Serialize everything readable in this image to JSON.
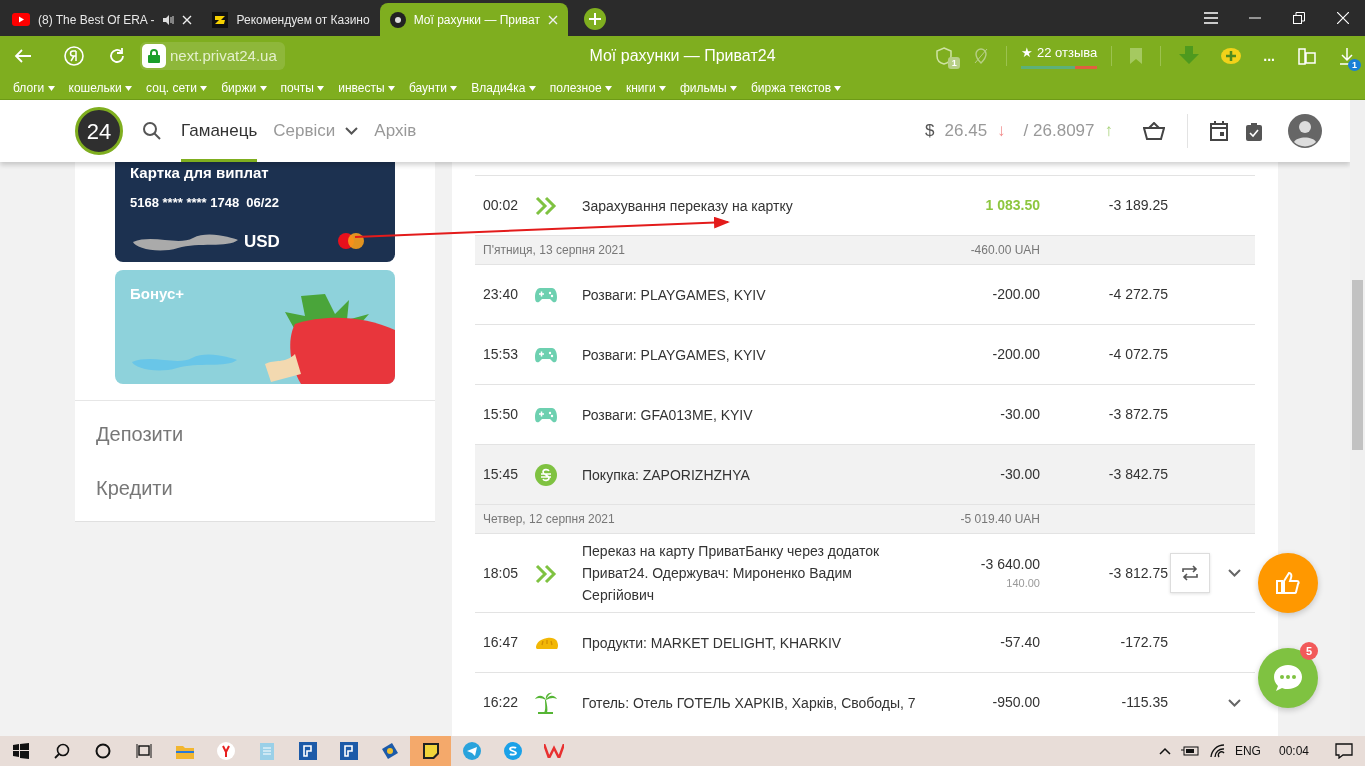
{
  "browser": {
    "tabs": [
      {
        "title": "(8) The Best Of ERA -",
        "kind": "youtube",
        "audio": true,
        "closable": true,
        "selected": false
      },
      {
        "title": "Рекомендуем от Казино",
        "kind": "casino",
        "audio": false,
        "closable": false,
        "selected": false
      },
      {
        "title": "Мої рахунки — Приват",
        "kind": "privat",
        "audio": false,
        "closable": true,
        "selected": true
      }
    ],
    "address": "next.privat24.ua",
    "page_title": "Мої рахунки — Приват24",
    "shield_badge": "1",
    "reviews": {
      "label": "★ 22 отзыва",
      "level": 0.7
    },
    "more": "...",
    "downloads_badge": "1",
    "bookmarks": [
      "блоги",
      "кошельки",
      "соц. сети",
      "биржи",
      "почты",
      "инвесты",
      "баунти",
      "Влади4ка",
      "полезное",
      "книги",
      "фильмы",
      "биржа текстов"
    ]
  },
  "site": {
    "logo": "24",
    "nav": [
      {
        "label": "Гаманець",
        "selected": true,
        "dropdown": false
      },
      {
        "label": "Сервіси",
        "selected": false,
        "dropdown": true
      },
      {
        "label": "Архів",
        "selected": false,
        "dropdown": false
      }
    ],
    "rate": {
      "currency": "$",
      "buy": "26.45",
      "buy_arrow": "↓",
      "sell": "/ 26.8097",
      "sell_arrow": "↑"
    }
  },
  "cards": [
    {
      "kind": "payout",
      "title": "Картка для виплат",
      "number": "5168 **** **** 1748  06/22",
      "balance": "USD"
    },
    {
      "kind": "bonus",
      "title": "Бонус+"
    }
  ],
  "menu": [
    "Депозити",
    "Кредити"
  ],
  "transactions": [
    {
      "kind": "tx",
      "time": "00:02",
      "icon": {
        "kind": "transfer"
      },
      "text": "Зарахування переказу на картку",
      "amount": "1 083.50",
      "income": true,
      "balance": "-3 189.25",
      "hovered": false,
      "repeat": false,
      "expandable": false
    },
    {
      "kind": "date",
      "label": "П'ятниця, 13 серпня 2021",
      "total": "-460.00 UAH"
    },
    {
      "kind": "tx",
      "time": "23:40",
      "icon": {
        "kind": "game"
      },
      "text": "Розваги: PLAYGAMES, KYIV",
      "amount": "-200.00",
      "income": false,
      "balance": "-4 272.75",
      "hovered": false,
      "repeat": false,
      "expandable": false
    },
    {
      "kind": "tx",
      "time": "15:53",
      "icon": {
        "kind": "game"
      },
      "text": "Розваги: PLAYGAMES, KYIV",
      "amount": "-200.00",
      "income": false,
      "balance": "-4 072.75",
      "hovered": false,
      "repeat": false,
      "expandable": false
    },
    {
      "kind": "tx",
      "time": "15:50",
      "icon": {
        "kind": "game"
      },
      "text": "Розваги: GFA013ME, KYIV",
      "amount": "-30.00",
      "income": false,
      "balance": "-3 872.75",
      "hovered": false,
      "repeat": false,
      "expandable": false
    },
    {
      "kind": "tx",
      "time": "15:45",
      "icon": {
        "kind": "purchase"
      },
      "text": "Покупка: ZAPORIZHZHYA",
      "amount": "-30.00",
      "income": false,
      "balance": "-3 842.75",
      "hovered": true,
      "repeat": false,
      "expandable": false
    },
    {
      "kind": "date",
      "label": "Четвер, 12 серпня 2021",
      "total": "-5 019.40 UAH"
    },
    {
      "kind": "tx",
      "time": "18:05",
      "icon": {
        "kind": "transfer"
      },
      "text": "Переказ на карту ПриватБанку через додаток Приват24. Одержувач: Мироненко Вадим Сергійович",
      "amount": "-3 640.00",
      "fee": "140.00",
      "income": false,
      "balance": "-3 812.75",
      "hovered": false,
      "repeat": true,
      "expandable": true
    },
    {
      "kind": "tx",
      "time": "16:47",
      "icon": {
        "kind": "food"
      },
      "text": "Продукти: MARKET DELIGHT, KHARKIV",
      "amount": "-57.40",
      "income": false,
      "balance": "-172.75",
      "hovered": false,
      "repeat": false,
      "expandable": false
    },
    {
      "kind": "tx",
      "time": "16:22",
      "icon": {
        "kind": "travel"
      },
      "text": "Готель: Отель ГОТЕЛЬ ХАРКІВ, Харків, Свободы, 7",
      "amount": "-950.00",
      "income": false,
      "balance": "-115.35",
      "hovered": false,
      "repeat": false,
      "expandable": true
    }
  ],
  "floating": {
    "chat_badge": "5"
  },
  "taskbar": {
    "apps": [
      {
        "kind": "folder",
        "active": false
      },
      {
        "kind": "yandex",
        "active": false
      },
      {
        "kind": "notepad",
        "active": false
      },
      {
        "kind": "blue",
        "active": false
      },
      {
        "kind": "blue",
        "active": false
      },
      {
        "kind": "app",
        "active": false
      },
      {
        "kind": "sticky",
        "active": true
      },
      {
        "kind": "telegram",
        "active": false
      },
      {
        "kind": "skype",
        "active": false
      },
      {
        "kind": "office",
        "active": false
      }
    ],
    "language": "ENG",
    "time": "00:04"
  }
}
